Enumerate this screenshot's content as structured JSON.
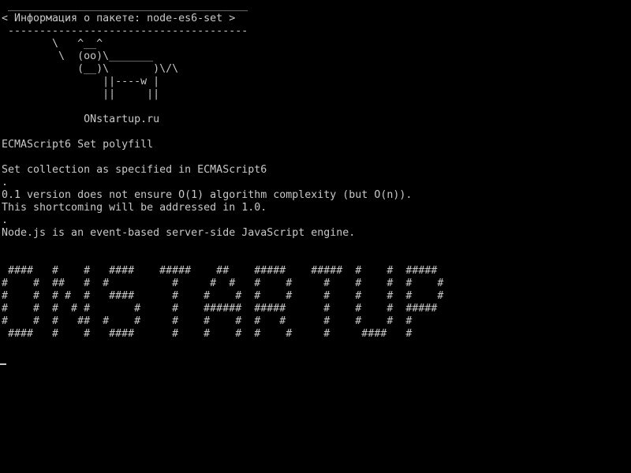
{
  "terminal": {
    "foreground_color": "#c8c8c8",
    "background_color": "#000000",
    "lines": [
      " ______________________________________",
      "< Информация о пакете: node-es6-set >",
      " --------------------------------------",
      "        \\   ^__^",
      "         \\  (oo)\\_______",
      "            (__)\\       )\\/\\",
      "                ||----w |",
      "                ||     ||",
      "",
      "             ONstartup.ru",
      "",
      "ECMAScript6 Set polyfill",
      "",
      "Set collection as specified in ECMAScript6",
      ".",
      "0.1 version does not ensure O(1) algorithm complexity (but O(n)).",
      "This shortcoming will be addressed in 1.0.",
      ".",
      "Node.js is an event-based server-side JavaScript engine.",
      "",
      "",
      " ####   #    #   ####    #####    ##    #####    #####  #    #  #####",
      "#    #  ##   #  #          #     #  #   #    #     #    #    #  #    #",
      "#    #  # #  #   ####      #    #    #  #    #     #    #    #  #    #",
      "#    #  #  # #       #     #    ######  #####      #    #    #  #####",
      "#    #  #   ##  #    #     #    #    #  #   #      #    #    #  #",
      " ####   #    #   ####      #    #    #  #    #     #     ####   #",
      ""
    ]
  }
}
